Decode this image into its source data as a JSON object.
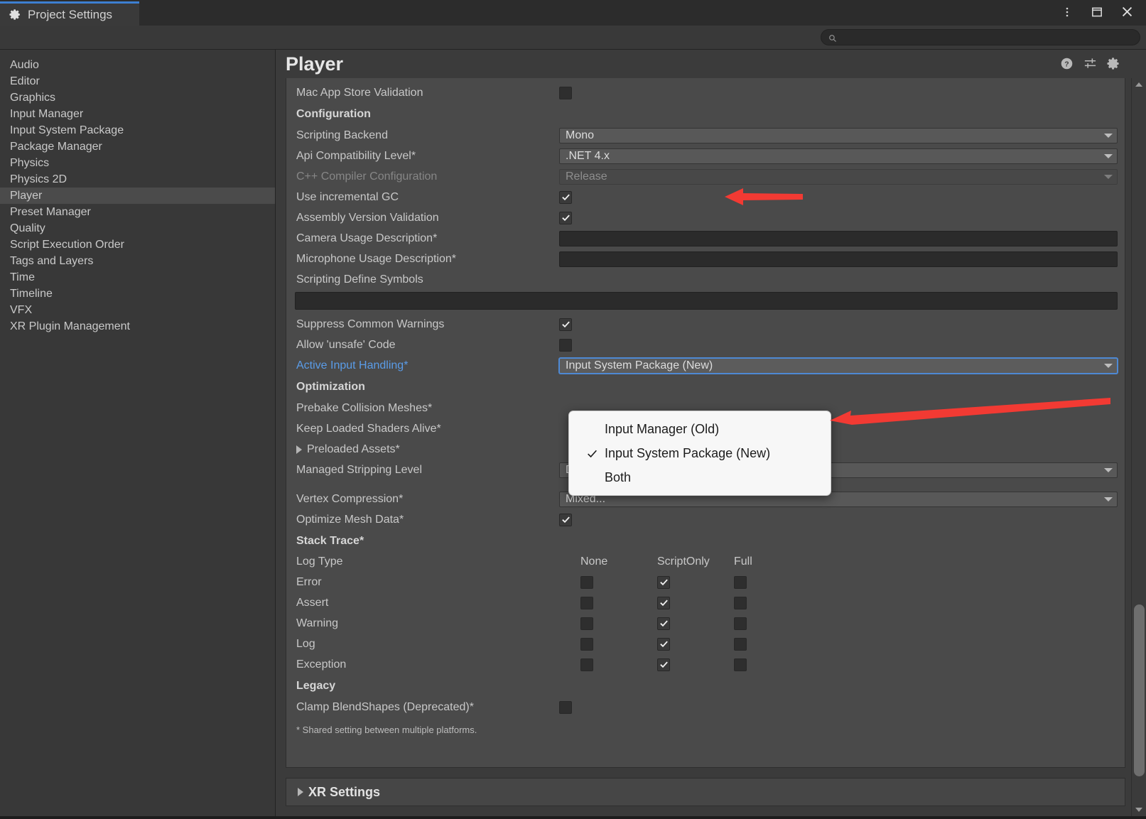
{
  "window": {
    "tab_title": "Project Settings",
    "controls": {
      "menu": "⋮",
      "maximize": "maximize",
      "close": "close"
    }
  },
  "search": {
    "value": "",
    "placeholder": ""
  },
  "sidebar": {
    "items": [
      {
        "label": "Audio",
        "selected": false
      },
      {
        "label": "Editor",
        "selected": false
      },
      {
        "label": "Graphics",
        "selected": false
      },
      {
        "label": "Input Manager",
        "selected": false
      },
      {
        "label": "Input System Package",
        "selected": false
      },
      {
        "label": "Package Manager",
        "selected": false
      },
      {
        "label": "Physics",
        "selected": false
      },
      {
        "label": "Physics 2D",
        "selected": false
      },
      {
        "label": "Player",
        "selected": true
      },
      {
        "label": "Preset Manager",
        "selected": false
      },
      {
        "label": "Quality",
        "selected": false
      },
      {
        "label": "Script Execution Order",
        "selected": false
      },
      {
        "label": "Tags and Layers",
        "selected": false
      },
      {
        "label": "Time",
        "selected": false
      },
      {
        "label": "Timeline",
        "selected": false
      },
      {
        "label": "VFX",
        "selected": false
      },
      {
        "label": "XR Plugin Management",
        "selected": false
      }
    ]
  },
  "main": {
    "title": "Player",
    "top_row": {
      "label": "Mac App Store Validation",
      "checked": false
    },
    "sections": {
      "configuration": {
        "heading": "Configuration",
        "scripting_backend": {
          "label": "Scripting Backend",
          "value": "Mono"
        },
        "api_compat": {
          "label": "Api Compatibility Level*",
          "value": ".NET 4.x"
        },
        "cpp_compiler": {
          "label": "C++ Compiler Configuration",
          "value": "Release"
        },
        "incremental_gc": {
          "label": "Use incremental GC",
          "checked": true
        },
        "assembly_version": {
          "label": "Assembly Version Validation",
          "checked": true
        },
        "camera_usage": {
          "label": "Camera Usage Description*",
          "value": ""
        },
        "microphone_usage": {
          "label": "Microphone Usage Description*",
          "value": ""
        },
        "define_symbols": {
          "label": "Scripting Define Symbols",
          "value": ""
        },
        "suppress_warnings": {
          "label": "Suppress Common Warnings",
          "checked": true
        },
        "unsafe_code": {
          "label": "Allow 'unsafe' Code",
          "checked": false
        },
        "active_input": {
          "label": "Active Input Handling*",
          "value": "Input System Package (New)"
        }
      },
      "optimization": {
        "heading": "Optimization",
        "prebake": {
          "label": "Prebake Collision Meshes*"
        },
        "keep_shaders": {
          "label": "Keep Loaded Shaders Alive*"
        },
        "preloaded_assets": {
          "label": "Preloaded Assets*"
        },
        "stripping": {
          "label": "Managed Stripping Level",
          "value": "Disabled"
        },
        "vertex_compression": {
          "label": "Vertex Compression*",
          "value": "Mixed..."
        },
        "optimize_mesh": {
          "label": "Optimize Mesh Data*",
          "checked": true
        }
      },
      "stack_trace": {
        "heading": "Stack Trace*",
        "columns": [
          "None",
          "ScriptOnly",
          "Full"
        ],
        "row_label_header": "Log Type",
        "rows": [
          {
            "label": "Error",
            "none": false,
            "scriptonly": true,
            "full": false
          },
          {
            "label": "Assert",
            "none": false,
            "scriptonly": true,
            "full": false
          },
          {
            "label": "Warning",
            "none": false,
            "scriptonly": true,
            "full": false
          },
          {
            "label": "Log",
            "none": false,
            "scriptonly": true,
            "full": false
          },
          {
            "label": "Exception",
            "none": false,
            "scriptonly": true,
            "full": false
          }
        ]
      },
      "legacy": {
        "heading": "Legacy",
        "clamp_blendshapes": {
          "label": "Clamp BlendShapes (Deprecated)*",
          "checked": false
        }
      }
    },
    "footnote": "* Shared setting between multiple platforms.",
    "xr_settings": {
      "label": "XR Settings"
    }
  },
  "dropdown_popup": {
    "items": [
      {
        "label": "Input Manager (Old)",
        "checked": false
      },
      {
        "label": "Input System Package (New)",
        "checked": true
      },
      {
        "label": "Both",
        "checked": false
      }
    ]
  },
  "annotations": {
    "arrow_color": "#f23a33"
  }
}
